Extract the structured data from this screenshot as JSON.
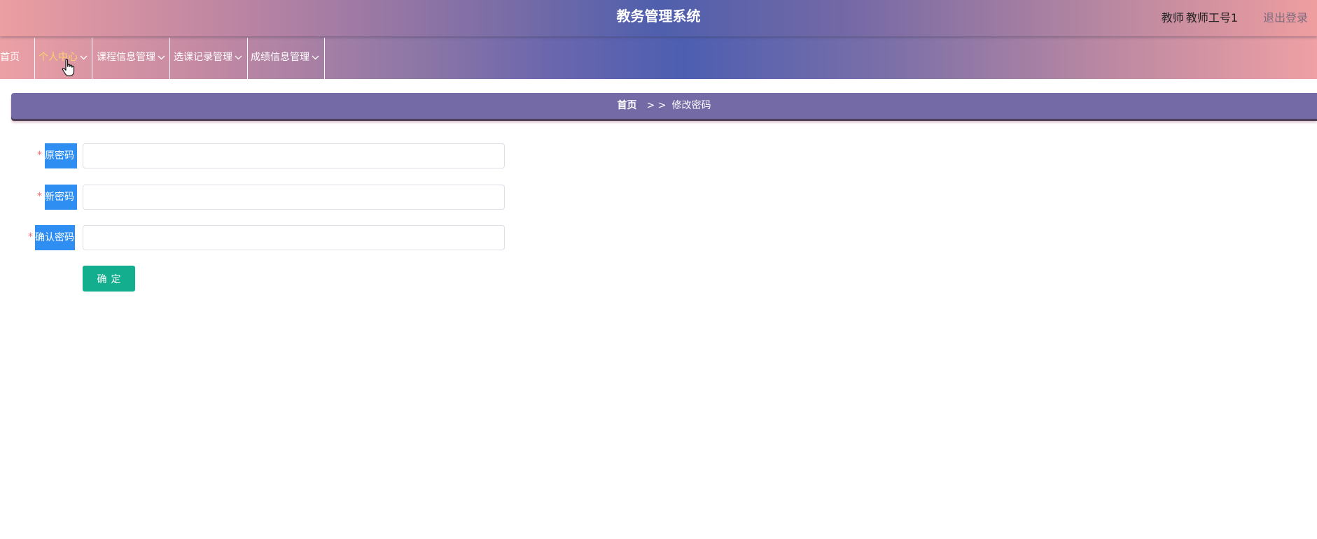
{
  "header": {
    "title": "教务管理系统",
    "user_role": "教师",
    "user_name": "教师工号1",
    "logout_label": "退出登录"
  },
  "nav": {
    "items": [
      {
        "label": "首页",
        "has_dropdown": false
      },
      {
        "label": "个人中心",
        "has_dropdown": true,
        "active": true
      },
      {
        "label": "课程信息管理",
        "has_dropdown": true
      },
      {
        "label": "选课记录管理",
        "has_dropdown": true
      },
      {
        "label": "成绩信息管理",
        "has_dropdown": true
      }
    ],
    "chevron_icon": "chevron-down-icon",
    "active_color": "#f8d36d"
  },
  "breadcrumb": {
    "home": "首页",
    "separator": "> >",
    "current": "修改密码"
  },
  "form": {
    "required_mark": "*",
    "fields": [
      {
        "label": "原密码",
        "value": "",
        "placeholder": ""
      },
      {
        "label": "新密码",
        "value": "",
        "placeholder": ""
      },
      {
        "label": "确认密码",
        "value": "",
        "placeholder": ""
      }
    ],
    "submit_label": "确定",
    "label_bg": "#2f8ef2",
    "submit_bg": "#12ae8d"
  },
  "colors": {
    "breadcrumb_bg": "#746aa6",
    "header_center": "#4f5fad",
    "header_edge": "#ec9ea1"
  }
}
